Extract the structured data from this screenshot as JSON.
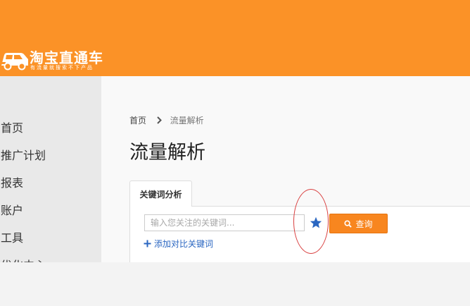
{
  "header": {
    "logo_title": "淘宝直通车",
    "logo_slogan": "有流量就搜索不下产品",
    "background_color": "#fb9227"
  },
  "sidebar": {
    "items": [
      {
        "label": "首页"
      },
      {
        "label": "推广计划"
      },
      {
        "label": "报表"
      },
      {
        "label": "账户"
      },
      {
        "label": "工具"
      },
      {
        "label": "优化中心"
      }
    ]
  },
  "breadcrumb": {
    "home": "首页",
    "current": "流量解析"
  },
  "page_title": "流量解析",
  "tab": {
    "label": "关键词分析"
  },
  "search": {
    "value": "",
    "placeholder": "输入您关注的关键词...",
    "button_label": "查询",
    "star_icon": "star-icon",
    "accent_color": "#f8861f"
  },
  "add_compare": {
    "label": "添加对比关键词"
  }
}
